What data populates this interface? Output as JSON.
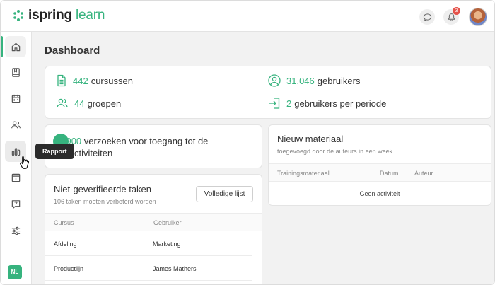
{
  "header": {
    "logo_main": "ispring",
    "logo_accent": "learn",
    "notifications_count": "3",
    "brand_color": "#36b37e"
  },
  "sidebar": {
    "items": [
      {
        "icon": "home-icon",
        "active": true
      },
      {
        "icon": "book-icon"
      },
      {
        "icon": "calendar-icon"
      },
      {
        "icon": "users-icon"
      },
      {
        "icon": "bar-chart-icon",
        "hovered": true
      },
      {
        "icon": "info-icon"
      },
      {
        "icon": "help-icon"
      },
      {
        "icon": "settings-sliders-icon"
      }
    ],
    "user_initials": "NL"
  },
  "tooltip": "Rapport",
  "page_title": "Dashboard",
  "stats": {
    "courses_num": "442",
    "courses_label": "cursussen",
    "users_num": "31.046",
    "users_label": "gebruikers",
    "groups_num": "44",
    "groups_label": "groepen",
    "period_num": "2",
    "period_label": "gebruikers per periode"
  },
  "access": {
    "num": "17900",
    "text": "verzoeken voor toegang tot de eeractiviteiten"
  },
  "new_material": {
    "title": "Nieuw materiaal",
    "subtitle": "toegevoegd door de auteurs in een week",
    "columns": [
      "Trainingsmateriaal",
      "Datum",
      "Auteur"
    ],
    "empty": "Geen activiteit"
  },
  "unverified": {
    "title": "Niet-geverifieerde taken",
    "subtitle": "106 taken moeten verbeterd worden",
    "button": "Volledige lijst",
    "columns": [
      "Cursus",
      "Gebruiker"
    ],
    "rows": [
      {
        "course": "Afdeling",
        "user": "Marketing"
      },
      {
        "course": "Productlijn",
        "user": "James Mathers"
      }
    ]
  }
}
